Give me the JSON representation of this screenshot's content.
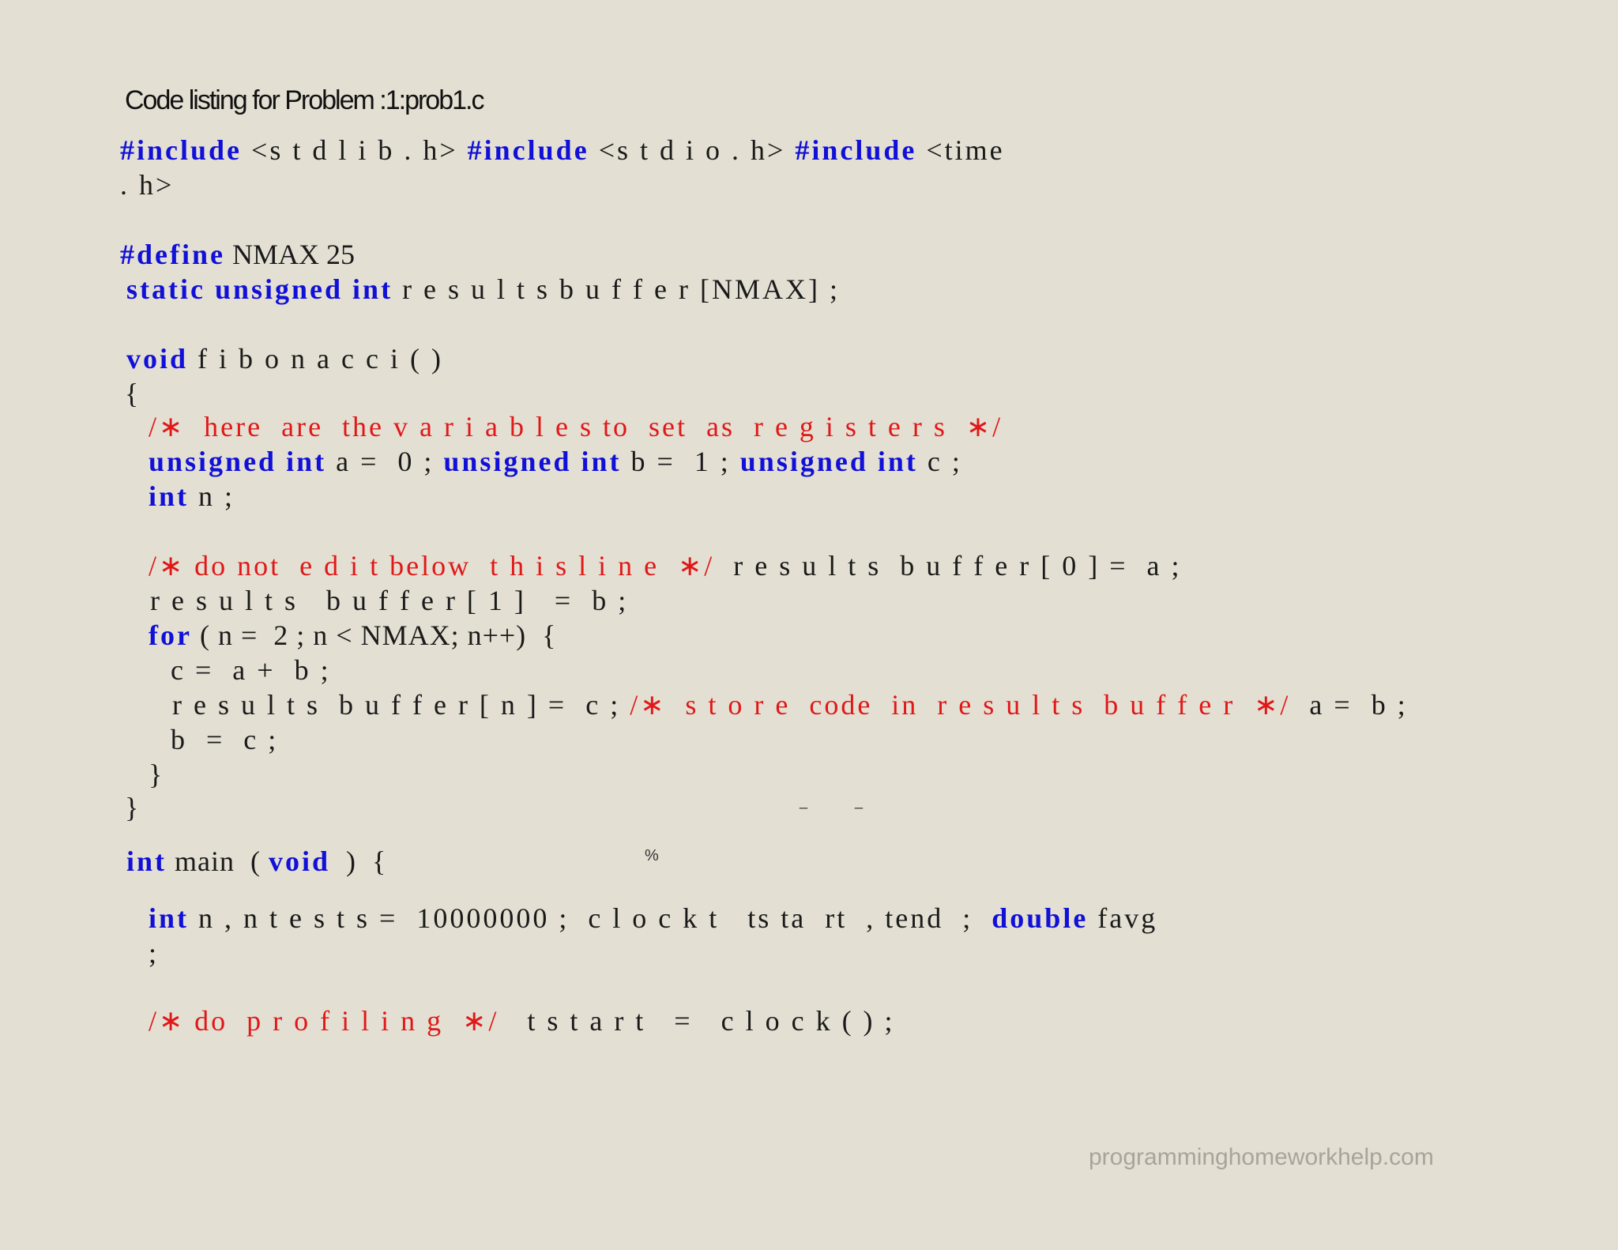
{
  "heading": "Code listing for Problem :1:prob1.c",
  "code": {
    "l1": {
      "k1": "#include",
      "t1": " <s t d l i b . h> ",
      "k2": "#include",
      "t2": " <s t d i o . h> ",
      "k3": "#include",
      "t3": " <time"
    },
    "l2": {
      "t1": ". h>"
    },
    "l3": {
      "k1": "#define",
      "t1": " NMAX 25"
    },
    "l4": {
      "k1": "static",
      "k2": "unsigned",
      "k3": "int",
      "t1": " r e s u l t s b u f f e r [NMAX] ;"
    },
    "l5": {
      "k1": "void",
      "t1": " f i b o n a c c i ( )"
    },
    "l6": {
      "t1": "{"
    },
    "l7": {
      "c1": "/∗  here  are  the v a r i a b l e s to  set  as  r e g i s t e r s  ∗/"
    },
    "l8": {
      "k1": "unsigned",
      "k2": "int",
      "t1": " a =  0 ; ",
      "k3": "unsigned",
      "k4": "int",
      "t2": " b =  1 ; ",
      "k5": "unsigned",
      "k6": "int",
      "t3": " c ;"
    },
    "l9": {
      "k1": "int",
      "t1": " n ;"
    },
    "l10": {
      "c1": "/∗ do not  e d i t below  t h i s l i n e  ∗/",
      "t1": "  r e s u l t s  b u f f e r [ 0 ] =  a ;"
    },
    "l11": {
      "t1": "r e s u l t s   b u f f e r [ 1 ]   =  b ;"
    },
    "l12": {
      "k1": "for",
      "t1": " ( n =  2 ; n < NMAX; n++)  {"
    },
    "l13": {
      "t1": "c =  a +  b ;"
    },
    "l14": {
      "t1": "r e s u l t s  b u f f e r [ n ] =  c ; ",
      "c1": "/∗  s t o r e  code  in  r e s u l t s  b u f f e r  ∗/",
      "t2": "  a =  b ;"
    },
    "l15": {
      "t1": "b  =  c ;"
    },
    "l16": {
      "t1": "}"
    },
    "l17": {
      "t1": "}"
    },
    "l18": {
      "k1": "int",
      "t1": " main  ( ",
      "k2": "void",
      "t2": "  )  {"
    },
    "l19": {
      "k1": "int",
      "t1": " n , n t e s t s =  10000000 ;  c l o c k t   ts ta  rt  , tend  ;  ",
      "k2": "double",
      "t2": " favg"
    },
    "l20": {
      "t1": ";"
    },
    "l21": {
      "c1": "/∗ do  p r o f i l i n g  ∗/",
      "t1": "   t s t a r t   =   c l o c k ( ) ;"
    },
    "mark1": "_",
    "mark2": "_",
    "mark3": "%"
  },
  "footer": "programminghomeworkhelp.com",
  "colors": {
    "background": "#e4dfd3",
    "keyword": "#1010d8",
    "comment": "#e01818",
    "text": "#1a1a1a",
    "footer": "#a8a49c"
  }
}
